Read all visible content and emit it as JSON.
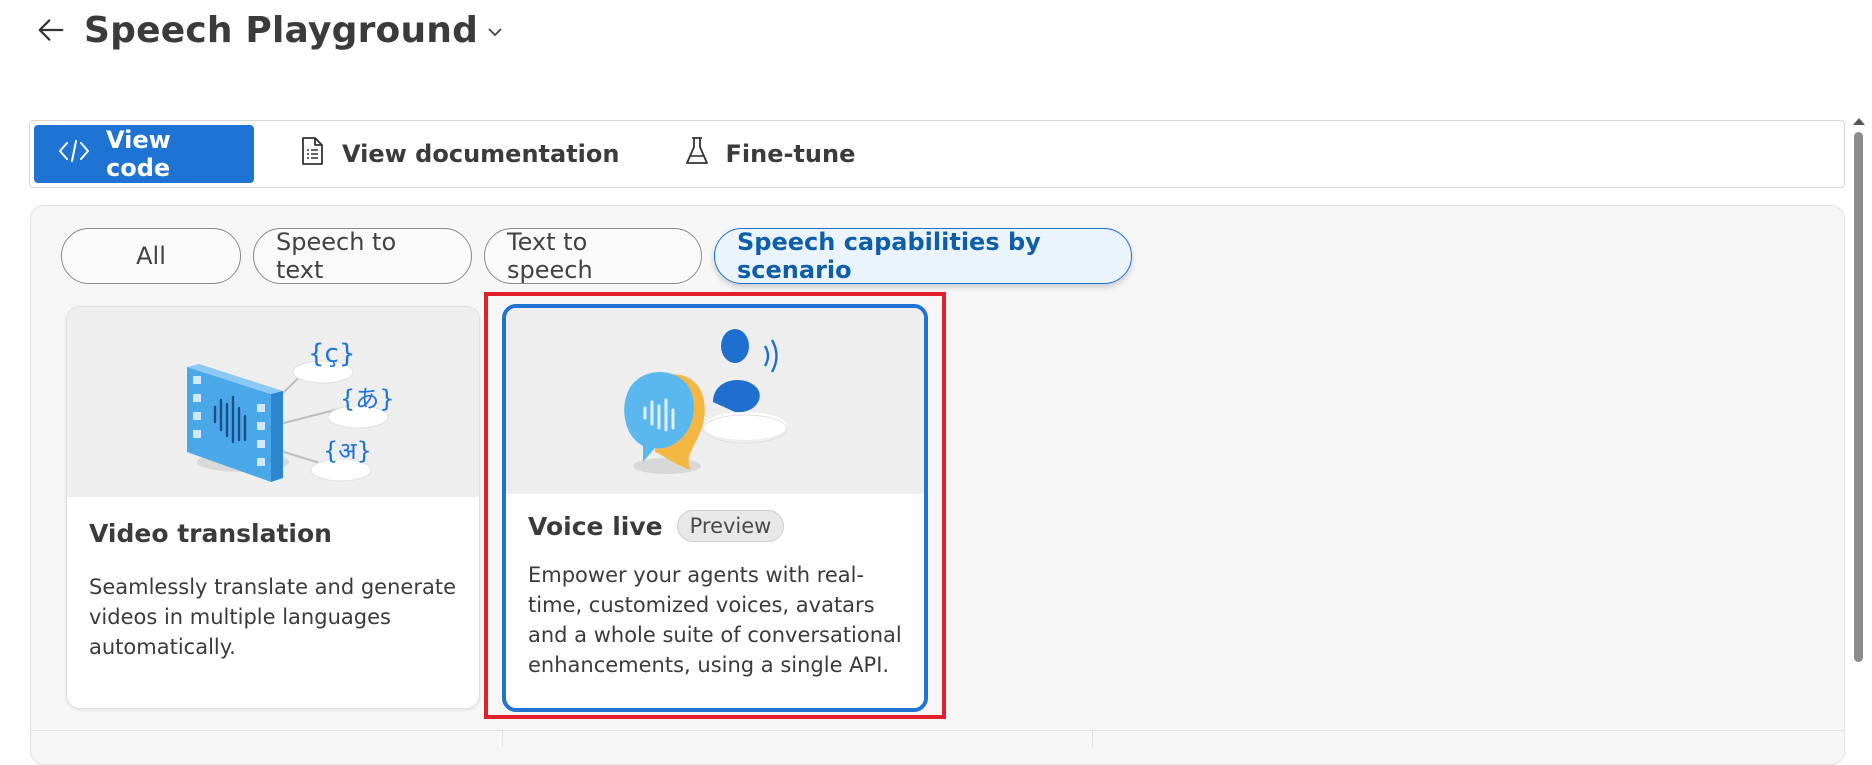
{
  "header": {
    "title": "Speech Playground"
  },
  "toolbar": {
    "view_code": "View code",
    "view_documentation": "View documentation",
    "fine_tune": "Fine-tune"
  },
  "filters": [
    {
      "label": "All",
      "active": false
    },
    {
      "label": "Speech to text",
      "active": false
    },
    {
      "label": "Text to speech",
      "active": false
    },
    {
      "label": "Speech capabilities by scenario",
      "active": true
    }
  ],
  "cards": [
    {
      "title": "Video translation",
      "description": "Seamlessly translate and generate videos in multiple languages automatically."
    },
    {
      "title": "Voice live",
      "badge": "Preview",
      "description": "Empower your agents with real-time, customized voices, avatars and a whole suite of conversational enhancements, using a single API."
    }
  ],
  "colors": {
    "accent": "#1f73d2",
    "highlight": "#e0202a"
  }
}
